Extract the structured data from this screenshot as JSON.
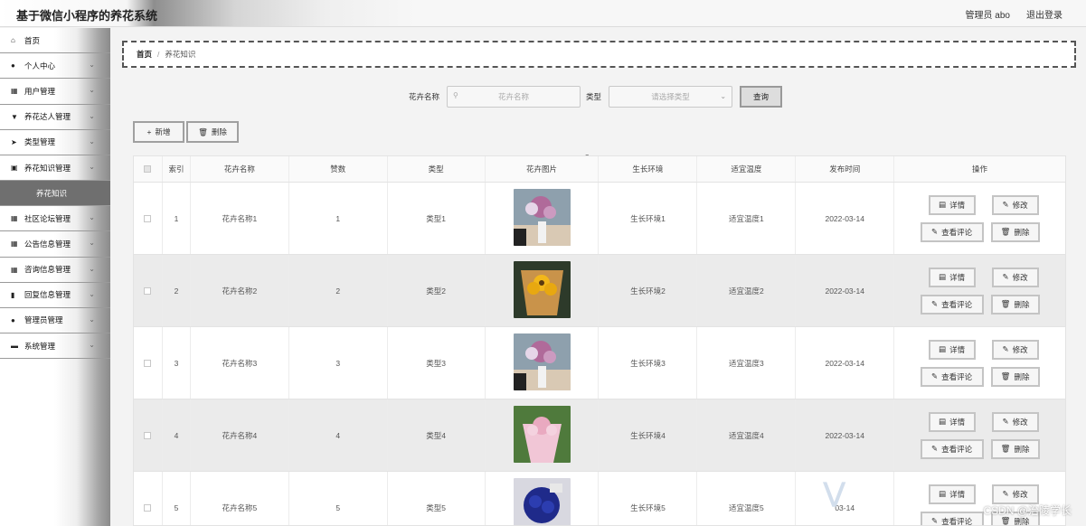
{
  "header": {
    "title": "基于微信小程序的养花系统",
    "user": "管理员 abo",
    "logout": "退出登录"
  },
  "sidebar": {
    "items": [
      {
        "label": "首页",
        "icon": "home-icon",
        "glyph": "⌂"
      },
      {
        "label": "个人中心",
        "icon": "user-icon",
        "glyph": "●"
      },
      {
        "label": "用户管理",
        "icon": "grid-icon",
        "glyph": "▦"
      },
      {
        "label": "养花达人管理",
        "icon": "badge-icon",
        "glyph": "▼"
      },
      {
        "label": "类型管理",
        "icon": "send-icon",
        "glyph": "➤"
      },
      {
        "label": "养花知识管理",
        "icon": "calendar-icon",
        "glyph": "▣"
      },
      {
        "label": "社区论坛管理",
        "icon": "grid-icon",
        "glyph": "▦"
      },
      {
        "label": "公告信息管理",
        "icon": "grid-icon",
        "glyph": "▦"
      },
      {
        "label": "咨询信息管理",
        "icon": "grid-icon",
        "glyph": "▦"
      },
      {
        "label": "回复信息管理",
        "icon": "bar-chart-icon",
        "glyph": "▮"
      },
      {
        "label": "管理员管理",
        "icon": "user-icon",
        "glyph": "●"
      },
      {
        "label": "系统管理",
        "icon": "settings-icon",
        "glyph": "▬"
      }
    ],
    "active_sub": "养花知识"
  },
  "breadcrumb": {
    "home": "首页",
    "sep": "/",
    "current": "养花知识"
  },
  "search": {
    "name_label": "花卉名称",
    "name_placeholder": "花卉名称",
    "type_label": "类型",
    "type_placeholder": "请选择类型",
    "query_button": "查询"
  },
  "actions": {
    "add": "新增",
    "delete": "删除"
  },
  "table": {
    "headers": [
      "索引",
      "花卉名称",
      "赞数",
      "类型",
      "花卉图片",
      "生长环境",
      "适宜温度",
      "发布时间",
      "操作"
    ],
    "rows": [
      {
        "index": "1",
        "name": "花卉名称1",
        "likes": "1",
        "type": "类型1",
        "env": "生长环境1",
        "temp": "适宜温度1",
        "date": "2022-03-14"
      },
      {
        "index": "2",
        "name": "花卉名称2",
        "likes": "2",
        "type": "类型2",
        "env": "生长环境2",
        "temp": "适宜温度2",
        "date": "2022-03-14"
      },
      {
        "index": "3",
        "name": "花卉名称3",
        "likes": "3",
        "type": "类型3",
        "env": "生长环境3",
        "temp": "适宜温度3",
        "date": "2022-03-14"
      },
      {
        "index": "4",
        "name": "花卉名称4",
        "likes": "4",
        "type": "类型4",
        "env": "生长环境4",
        "temp": "适宜温度4",
        "date": "2022-03-14"
      },
      {
        "index": "5",
        "name": "花卉名称5",
        "likes": "5",
        "type": "类型5",
        "env": "生长环境5",
        "temp": "适宜温度5",
        "date": "03-14"
      }
    ],
    "row_ops": {
      "detail": "详情",
      "edit": "修改",
      "comments": "查看评论",
      "delete": "删除"
    }
  },
  "watermark": "CSDN @治陵学长"
}
